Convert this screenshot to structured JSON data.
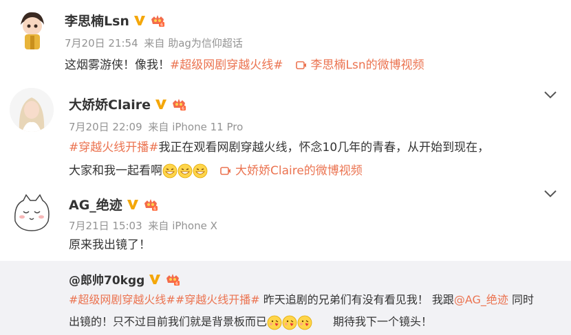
{
  "posts": [
    {
      "name": "李思楠Lsn",
      "date": "7月20日 21:54",
      "source": "来自 助ag为信仰超话",
      "text": "这烟雾游侠！像我！",
      "topic": "#超级网剧穿越火线#",
      "video_link": "李思楠Lsn的微博视频"
    },
    {
      "name": "大娇娇Claire",
      "date": "7月20日 22:09",
      "source": "来自 iPhone 11 Pro",
      "topic": "#穿越火线开播#",
      "text_line1": "我正在观看网剧穿越火线，怀念10几年的青春，从开始到现在，",
      "text_line2": "大家和我一起看啊",
      "video_link": "大娇娇Claire的微博视频"
    },
    {
      "name": "AG_绝迹",
      "date": "7月21日 15:03",
      "source": "来自 iPhone X",
      "text": "原来我出镜了！"
    }
  ],
  "repost": {
    "name": "@郎帅70kgg",
    "topic1": "#超级网剧穿越火线#",
    "topic2": "#穿越火线开播#",
    "text_a": "昨天追剧的兄弟们有没有看见我！  我跟",
    "mention": "@AG_绝迹",
    "text_b": "同时",
    "text_line2": "出镜的！只不过目前我们就是背景板而已",
    "text_c": "期待我下一个镜头！"
  },
  "icons": [
    "verified-v-icon",
    "crown-badge-icon",
    "video-icon",
    "chevron-down-icon",
    "grin-emoji-icon",
    "kiss-emoji-icon"
  ],
  "colors": {
    "topic": "#eb7350",
    "verified": "#f4a70a",
    "meta": "#939393",
    "repost_bg": "#f2f2f5"
  }
}
